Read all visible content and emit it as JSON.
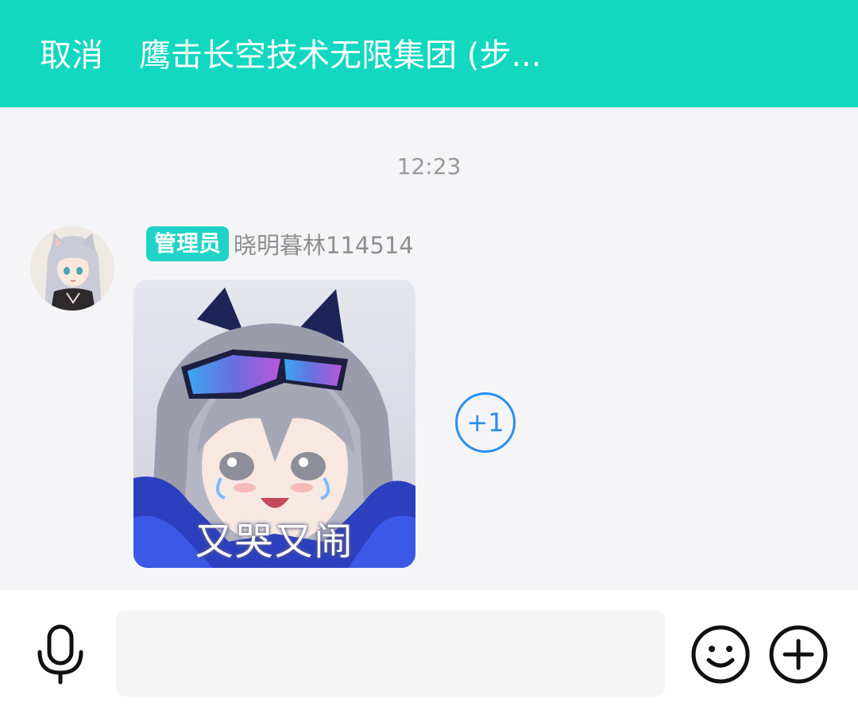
{
  "header": {
    "cancel_label": "取消",
    "title": "鹰击长空技术无限集团 (步..."
  },
  "chat": {
    "timestamp": "12:23",
    "message": {
      "role_badge": "管理员",
      "sender_name": "晓明暮林114514",
      "sticker_caption": "又哭又闹",
      "reaction_label": "+1"
    }
  },
  "input_bar": {
    "text_placeholder": "",
    "icons": [
      "microphone-icon",
      "emoji-icon",
      "plus-icon"
    ]
  },
  "colors": {
    "header_bg": "#12d8c0",
    "badge_bg": "#1fd3c6",
    "reaction_accent": "#2a8ef0",
    "chat_bg": "#f5f5f8"
  }
}
